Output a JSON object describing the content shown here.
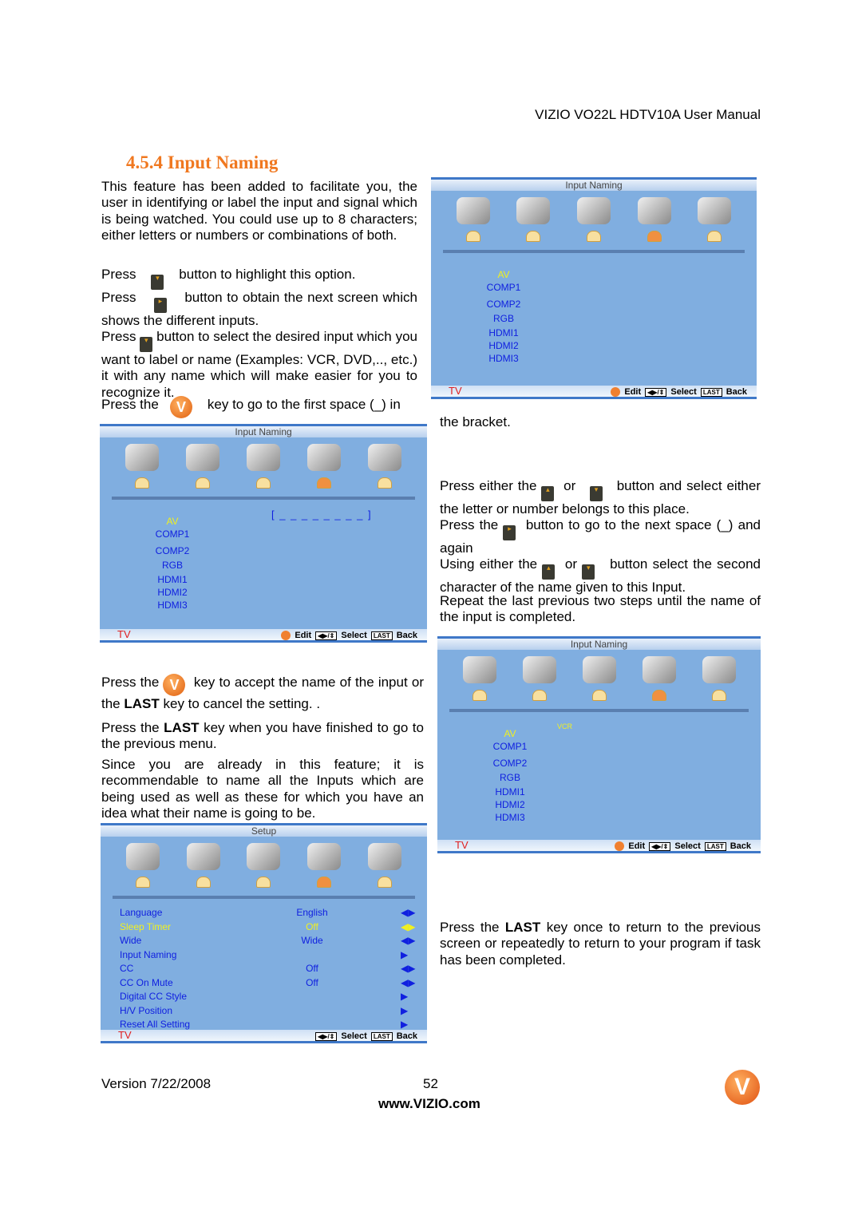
{
  "header": "VIZIO VO22L HDTV10A User Manual",
  "section_title": "4.5.4 Input Naming",
  "left_text": {
    "p1": "This feature has been added to facilitate you, the user in identifying or label the input and signal which is being watched. You could use up to 8 characters; either letters or numbers or combinations of both.",
    "p2a": "Press",
    "p2b": "button to highlight this option.",
    "p3a": "Press",
    "p3b": "button to obtain the next screen which shows the different inputs.",
    "p4a": "Press",
    "p4b": "button to select the desired input which you want to label or name (Examples: VCR, DVD,.., etc.) it with any name which will make easier for you to recognize it.",
    "p5a": "Press the",
    "p5b": "key to go to the first space (_) in",
    "p6a": "Press the",
    "p6b": "key to accept the name of the input or the",
    "p6c": "LAST",
    "p6d": "key to cancel the setting. .",
    "p7a": "Press the",
    "p7b": "LAST",
    "p7c": "key when you have finished to go to the previous menu.",
    "p8": "Since you are already in this feature; it is recommendable to name all the Inputs which are being used as well as these for which you have an idea what their name is going to be."
  },
  "right_text": {
    "r1": "the bracket.",
    "r2a": "Press either the",
    "r2b": "or",
    "r2c": "button and select either the letter or number belongs to this place.",
    "r3a": "Press the",
    "r3b": "button to go to the next space (_) and again",
    "r4a": "Using either the",
    "r4b": "or",
    "r4c": "button select the second character of the name given to this Input.",
    "r5": "Repeat the last previous two steps until the name of the input is completed.",
    "r6a": "Press the",
    "r6b": "LAST",
    "r6c": "key once to return to the previous screen or repeatedly to return to your program if task has been completed."
  },
  "osd_common": {
    "tv": "TV",
    "edit": "Edit",
    "select": "Select",
    "last": "LAST",
    "back": "Back",
    "key_glyph": "◀▶/⇕",
    "icons": [
      "tv-picture-icon",
      "audio-microphone-icon",
      "satellite-tv-icon",
      "setup-wrench-icon",
      "parental-key-icon"
    ]
  },
  "osd_panels": [
    {
      "title": "Input Naming",
      "items": [
        "AV",
        "COMP1",
        "COMP2",
        "RGB",
        "HDMI1",
        "HDMI2",
        "HDMI3"
      ],
      "highlight": 0,
      "edit": true
    },
    {
      "title": "Input Naming",
      "items": [
        "AV",
        "COMP1",
        "COMP2",
        "RGB",
        "HDMI1",
        "HDMI2",
        "HDMI3"
      ],
      "highlight": 0,
      "edit": true,
      "name_field": "[ _ _ _ _ _ _ _ _ ]"
    },
    {
      "title": "Input Naming",
      "items": [
        "AV",
        "COMP1",
        "COMP2",
        "RGB",
        "HDMI1",
        "HDMI2",
        "HDMI3"
      ],
      "highlight": 0,
      "edit": true,
      "name_field": "VCR"
    },
    {
      "title": "Setup",
      "edit": false,
      "setup_rows": [
        {
          "label": "Language",
          "value": "English",
          "arrow": "◀▶"
        },
        {
          "label": "Sleep Timer",
          "value": "Off",
          "arrow": "◀▶",
          "highlight": true
        },
        {
          "label": "Wide",
          "value": "Wide",
          "arrow": "◀▶"
        },
        {
          "label": "Input Naming",
          "value": "",
          "arrow": "▶"
        },
        {
          "label": "CC",
          "value": "Off",
          "arrow": "◀▶"
        },
        {
          "label": "CC On Mute",
          "value": "Off",
          "arrow": "◀▶"
        },
        {
          "label": "Digital CC Style",
          "value": "",
          "arrow": "▶"
        },
        {
          "label": "H/V Position",
          "value": "",
          "arrow": "▶"
        },
        {
          "label": "Reset All Setting",
          "value": "",
          "arrow": "▶"
        }
      ]
    }
  ],
  "footer": {
    "version": "Version 7/22/2008",
    "page": "52",
    "url": "www.VIZIO.com"
  },
  "logo_text": "V",
  "vkey_glyph": "V"
}
